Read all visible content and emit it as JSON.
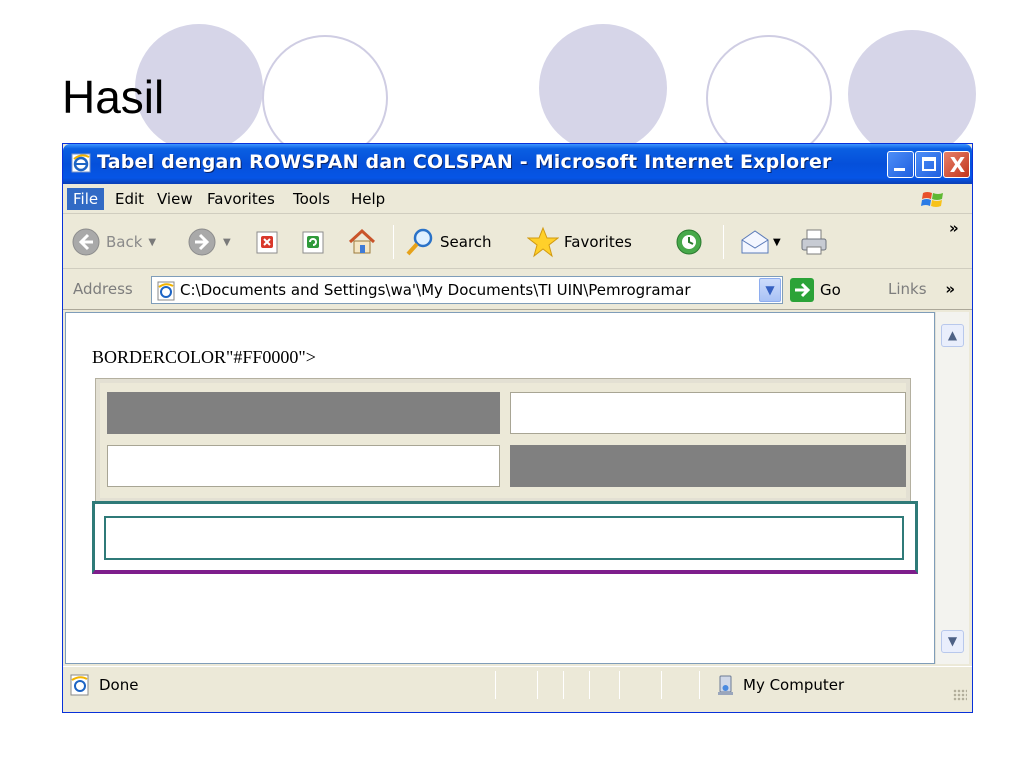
{
  "slide": {
    "title": "Hasil"
  },
  "window": {
    "title": "Tabel dengan ROWSPAN dan COLSPAN - Microsoft Internet Explorer",
    "close_glyph": "X"
  },
  "menu": {
    "items": [
      "File",
      "Edit",
      "View",
      "Favorites",
      "Tools",
      "Help"
    ]
  },
  "toolbar": {
    "back_label": "Back",
    "search_label": "Search",
    "favorites_label": "Favorites",
    "overflow": "»"
  },
  "address": {
    "label": "Address",
    "value": "C:\\Documents and Settings\\wa'\\My Documents\\TI UIN\\Pemrogramar",
    "go_label": "Go",
    "links_label": "Links",
    "links_overflow": "»"
  },
  "content": {
    "text": "BORDERCOLOR\"#FF0000\">"
  },
  "status": {
    "text": "Done",
    "zone": "My Computer"
  },
  "colors": {
    "slide_circle": "#d6d5e8",
    "titlebar": "#0550da",
    "gray_cell": "#808080",
    "teal_border": "#2f7a78",
    "purple_border": "#7e1e8c"
  }
}
